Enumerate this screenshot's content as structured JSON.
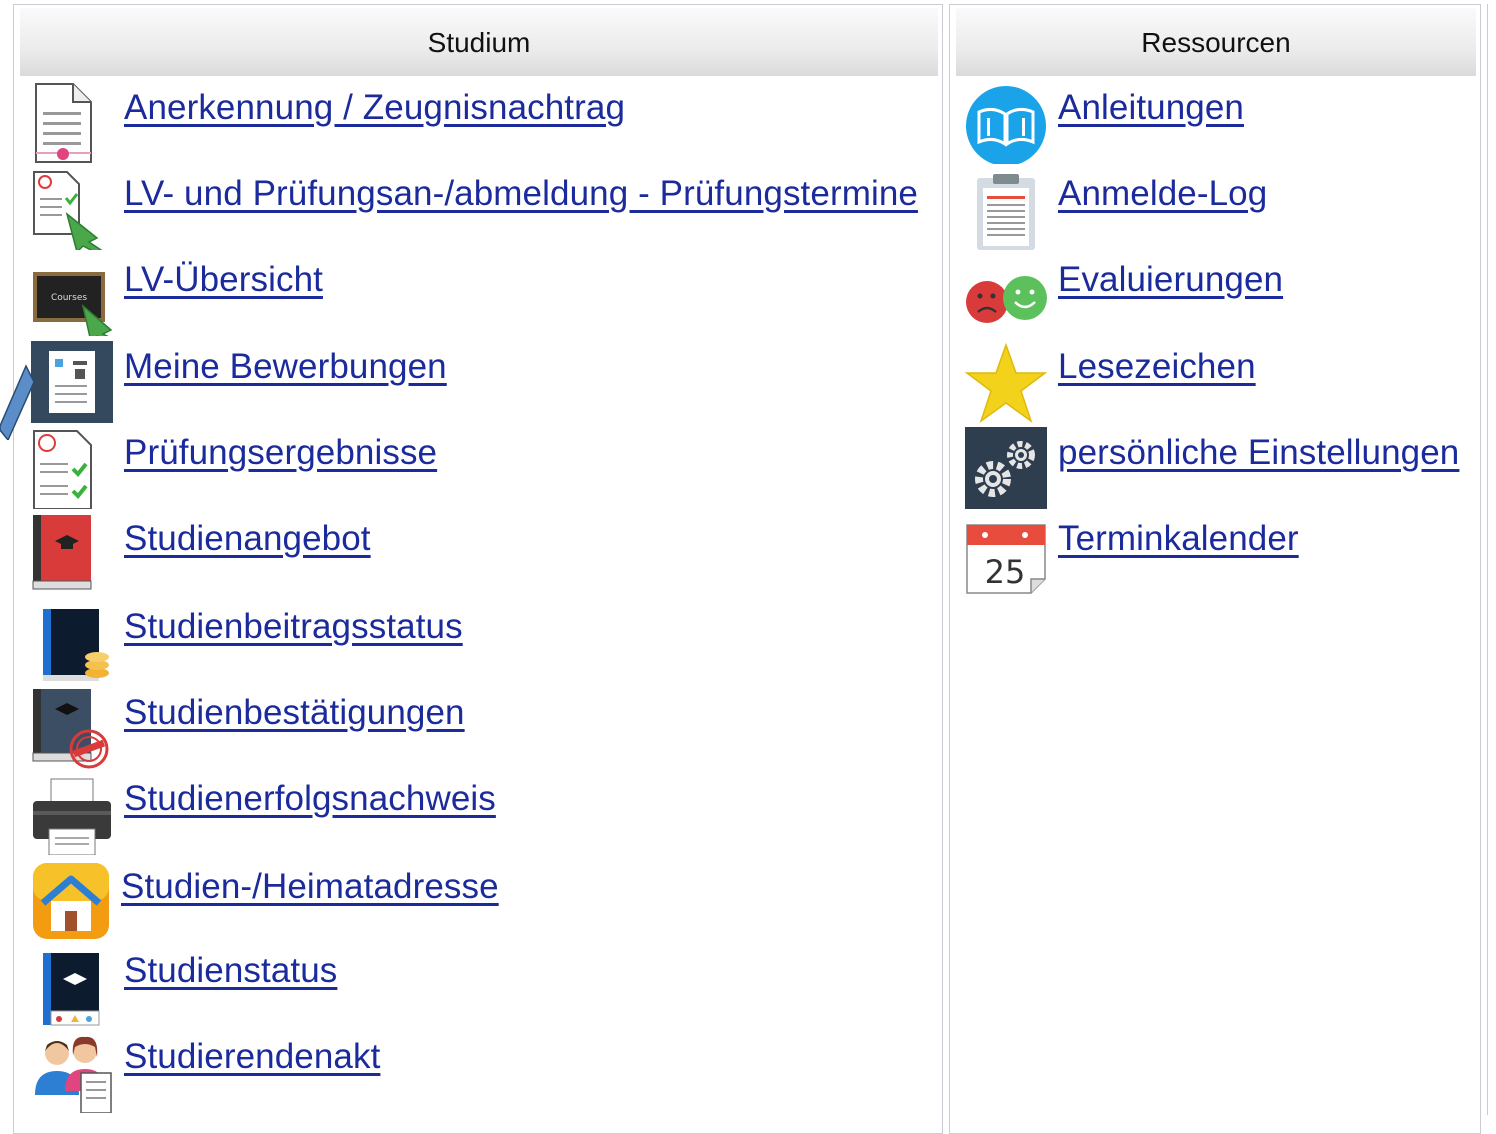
{
  "studium": {
    "header": "Studium",
    "items": [
      {
        "label": "Anerkennung / Zeugnisnachtrag",
        "icon": "certificate-document-icon"
      },
      {
        "label": "LV- und Prüfungsan-/abmeldung - Prüfungstermine",
        "icon": "exam-registration-icon"
      },
      {
        "label": "LV-Übersicht",
        "icon": "blackboard-courses-icon"
      },
      {
        "label": "Meine Bewerbungen",
        "icon": "applications-document-icon"
      },
      {
        "label": "Prüfungsergebnisse",
        "icon": "exam-results-checklist-icon"
      },
      {
        "label": "Studienangebot",
        "icon": "red-book-graduation-icon"
      },
      {
        "label": "Studienbeitragsstatus",
        "icon": "book-coins-icon"
      },
      {
        "label": "Studienbestätigungen",
        "icon": "book-approved-stamp-icon"
      },
      {
        "label": "Studienerfolgsnachweis",
        "icon": "printer-icon"
      },
      {
        "label": "Studien-/Heimatadresse",
        "icon": "home-address-icon"
      },
      {
        "label": "Studienstatus",
        "icon": "book-status-icon"
      },
      {
        "label": "Studierendenakt",
        "icon": "students-file-icon"
      }
    ]
  },
  "ressourcen": {
    "header": "Ressourcen",
    "items": [
      {
        "label": "Anleitungen",
        "icon": "open-book-manual-icon"
      },
      {
        "label": "Anmelde-Log",
        "icon": "clipboard-log-icon"
      },
      {
        "label": "Evaluierungen",
        "icon": "sad-happy-faces-icon"
      },
      {
        "label": "Lesezeichen",
        "icon": "star-bookmark-icon"
      },
      {
        "label": "persönliche Einstellungen",
        "icon": "gears-settings-icon"
      },
      {
        "label": "Terminkalender",
        "icon": "calendar-icon"
      }
    ]
  },
  "calendar_day": "25",
  "colors": {
    "link": "#1b2b9c",
    "pointer": "#5b8ec8"
  }
}
